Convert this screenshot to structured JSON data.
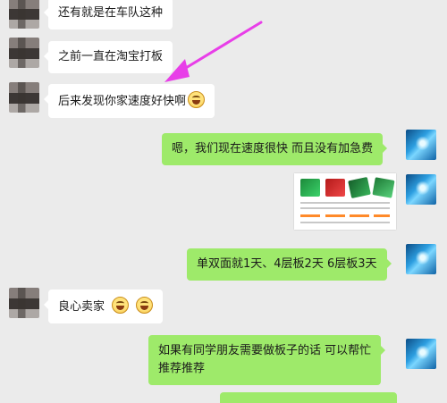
{
  "colors": {
    "background": "#ebebeb",
    "incoming_bubble": "#ffffff",
    "outgoing_bubble": "#9eea6a",
    "annotation_arrow": "#e83ee8"
  },
  "messages": [
    {
      "side": "left",
      "text": "还有就是在车队这种"
    },
    {
      "side": "left",
      "text": "之前一直在淘宝打板"
    },
    {
      "side": "left",
      "text": "后来发现你家速度好快啊",
      "emoji": "laugh-cry-emoji"
    },
    {
      "side": "right",
      "text": "嗯，我们现在速度很快    而且没有加急费"
    },
    {
      "side": "right",
      "type": "image",
      "image": "pcb-product-listing"
    },
    {
      "side": "right",
      "text": "单双面就1天、4层板2天    6层板3天"
    },
    {
      "side": "left",
      "text": "良心卖家",
      "emoji": "laugh-cry-emoji"
    },
    {
      "side": "right",
      "text_line1": "如果有同学朋友需要做板子的话    可以帮忙",
      "text_line2": "推荐推荐"
    }
  ]
}
